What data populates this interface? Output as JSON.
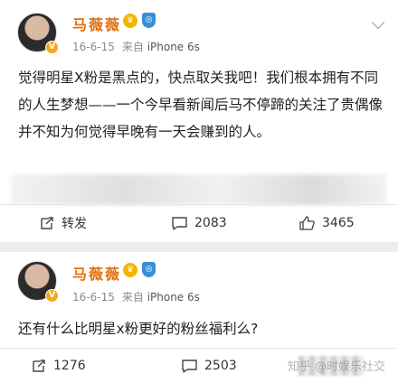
{
  "posts": [
    {
      "author": "马薇薇",
      "date": "16-6-15",
      "source_prefix": "来自",
      "source": "iPhone 6s",
      "text": "觉得明星X粉是黑点的，快点取关我吧！我们根本拥有不同的人生梦想——一个今早看新闻后马不停蹄的关注了贵偶像并不知为何觉得早晚有一天会赚到的人。",
      "repost_label": "转发",
      "comment_count": "2083",
      "like_count": "3465"
    },
    {
      "author": "马薇薇",
      "date": "16-6-15",
      "source_prefix": "来自",
      "source": "iPhone 6s",
      "text": "还有什么比明星x粉更好的粉丝福利么?",
      "repost_label": "1276",
      "comment_count": "2503",
      "like_count": ""
    }
  ],
  "watermark": "知乎 @时娱乐社交",
  "icons": {
    "repost": "repost-icon",
    "comment": "comment-icon",
    "like": "like-icon",
    "crown": "crown-badge-icon",
    "shield": "shield-badge-icon",
    "verified": "verified-v-icon",
    "more": "chevron-down-icon"
  },
  "colors": {
    "author_name": "#e2700c",
    "meta": "#8a8a8a",
    "background": "#ececec"
  }
}
